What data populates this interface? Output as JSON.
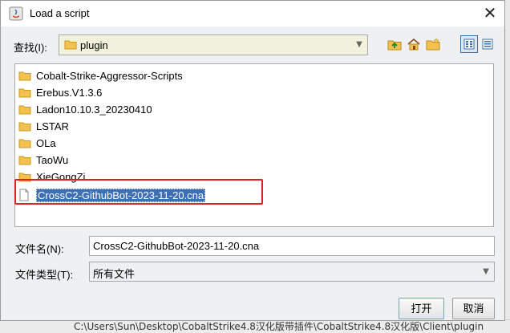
{
  "window": {
    "title": "Load a script",
    "close_glyph": "✕"
  },
  "lookin": {
    "label": "查找(I):",
    "value": "plugin"
  },
  "toolbar": {
    "icons": [
      "folder-up-icon",
      "home-icon",
      "new-folder-icon"
    ],
    "views": [
      "list-view-icon",
      "details-view-icon"
    ],
    "active_view": "list-view-icon"
  },
  "files": [
    {
      "name": "Cobalt-Strike-Aggressor-Scripts",
      "type": "folder"
    },
    {
      "name": "Erebus.V1.3.6",
      "type": "folder"
    },
    {
      "name": "Ladon10.10.3_20230410",
      "type": "folder"
    },
    {
      "name": "LSTAR",
      "type": "folder"
    },
    {
      "name": "OLa",
      "type": "folder"
    },
    {
      "name": "TaoWu",
      "type": "folder"
    },
    {
      "name": "XieGongZi",
      "type": "folder"
    },
    {
      "name": "CrossC2-GithubBot-2023-11-20.cna",
      "type": "file",
      "selected": true
    }
  ],
  "filename": {
    "label": "文件名(N):",
    "value": "CrossC2-GithubBot-2023-11-20.cna"
  },
  "filetype": {
    "label": "文件类型(T):",
    "value": "所有文件"
  },
  "buttons": {
    "open": "打开",
    "cancel": "取消"
  },
  "background": {
    "path_text": "C:\\Users\\Sun\\Desktop\\CobaltStrike4.8汉化版带插件\\CobaltStrike4.8汉化版\\Client\\plugin"
  },
  "colors": {
    "selection": "#3d6fb4",
    "highlight_box": "#e02020",
    "folder": "#f2c14e"
  }
}
